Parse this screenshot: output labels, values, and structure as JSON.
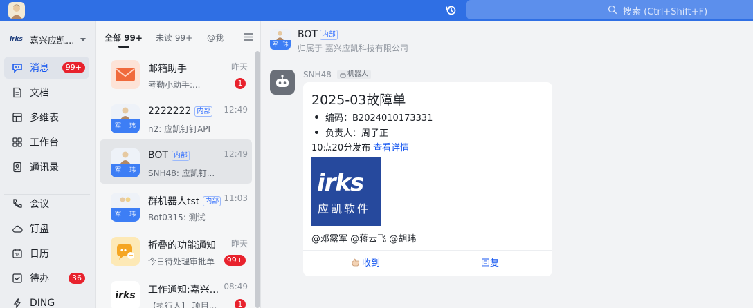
{
  "search": {
    "placeholder": "搜索 (Ctrl+Shift+F)"
  },
  "org": {
    "logo_text": "irks",
    "name": "嘉兴应凯..."
  },
  "nav": {
    "items": [
      {
        "label": "消息",
        "badge": "99+"
      },
      {
        "label": "文档"
      },
      {
        "label": "多维表"
      },
      {
        "label": "工作台"
      },
      {
        "label": "通讯录"
      },
      {
        "label": "会议"
      },
      {
        "label": "钉盘"
      },
      {
        "label": "日历"
      },
      {
        "label": "待办",
        "badge": "36"
      },
      {
        "label": "DING"
      }
    ]
  },
  "tabs": [
    {
      "label": "全部",
      "count": "99+"
    },
    {
      "label": "未读",
      "count": "99+"
    },
    {
      "label": "@我"
    }
  ],
  "conversations": [
    {
      "name": "邮箱助手",
      "preview": "考勤小助手:...",
      "time": "昨天",
      "badge": "1"
    },
    {
      "name": "2222222",
      "tag": "内部",
      "preview": "n2: 应凯钉钉API",
      "time": "12:49",
      "avatar_cells": [
        "军",
        "玮"
      ]
    },
    {
      "name": "BOT",
      "tag": "内部",
      "preview": "SNH48: 应凯钉...",
      "time": "12:49",
      "avatar_cells": [
        "军",
        "玮"
      ]
    },
    {
      "name": "群机器人tst",
      "tag": "内部",
      "preview": "Bot0315: 测试-",
      "time": "11:03",
      "avatar_cells": [
        "军",
        "玮"
      ]
    },
    {
      "name": "折叠的功能通知",
      "preview": "今日待处理审批单",
      "time": "昨天",
      "badge": "99+"
    },
    {
      "name": "工作通知:嘉兴...",
      "preview": "【执行人】 项目...",
      "time": "08:49",
      "badge": "1",
      "avatar_text": "irks"
    }
  ],
  "chat": {
    "title": "BOT",
    "tag": "内部",
    "subtitle": "归属于 嘉兴应凯科技有限公司",
    "avatar_cells": [
      "军",
      "玮"
    ],
    "message": {
      "sender": "SNH48",
      "sender_tag": "机器人",
      "card": {
        "title": "2025-03故障单",
        "items": [
          "编码：B2024010173331",
          "负责人：周子正"
        ],
        "meta": "10点20分发布",
        "link": "查看详情",
        "image": {
          "logo_text": "irks",
          "name_cn": "应凯软件"
        },
        "mentions": "@邓露军 @蒋云飞 @胡玮",
        "actions": [
          "收到",
          "回复"
        ]
      }
    }
  },
  "colors": {
    "topbar": "#2f6fe4",
    "accent": "#1456f0",
    "badge": "#e8222d",
    "card_image": "#26499d"
  }
}
